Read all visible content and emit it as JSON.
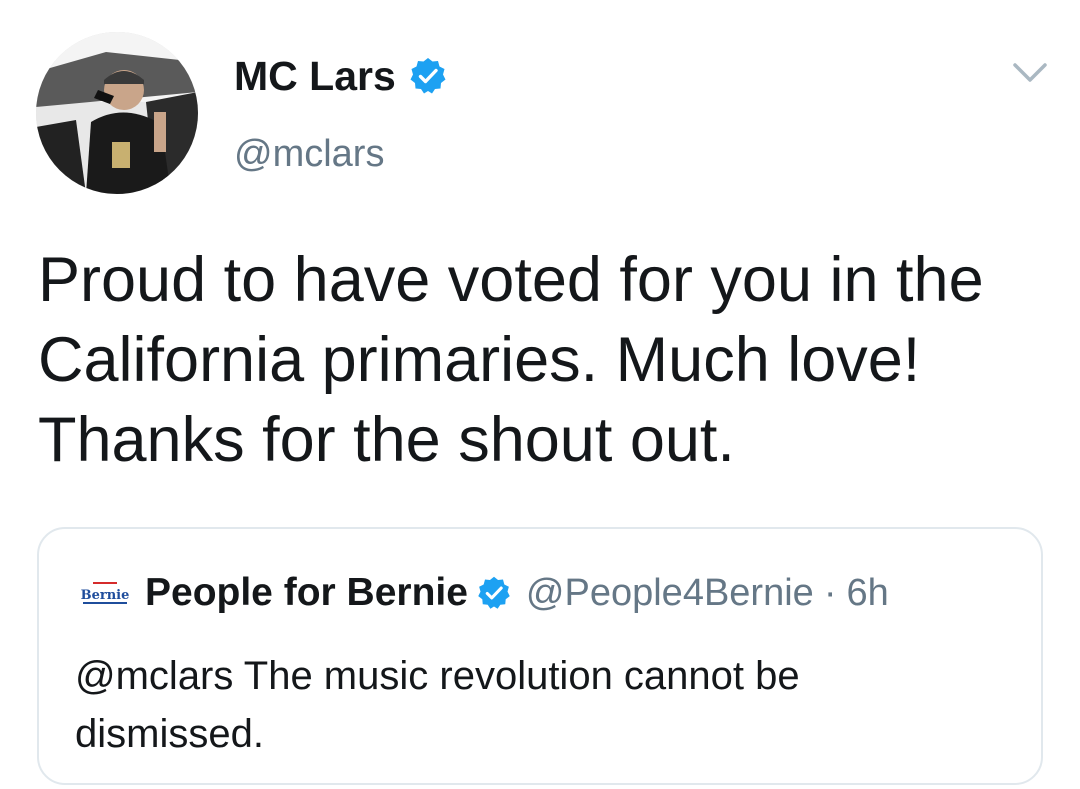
{
  "tweet": {
    "author": {
      "display_name": "MC Lars",
      "handle": "@mclars",
      "verified": true,
      "avatar_icon": "profile-photo"
    },
    "menu_icon": "chevron-down-icon",
    "text": "Proud to have voted for you in the\nCalifornia primaries.  Much love!\nThanks for the shout out."
  },
  "quoted_tweet": {
    "author": {
      "display_name": "People for Bernie",
      "handle": "@People4Bernie",
      "verified": true,
      "avatar_logo_text": "Bernie"
    },
    "separator": "·",
    "time": "6h",
    "text": "@mclars The music revolution cannot be dismissed."
  },
  "colors": {
    "verified_blue": "#1DA1F2",
    "secondary_text": "#657786",
    "primary_text": "#14171A",
    "card_border": "#E1E8ED",
    "bernie_blue": "#1f4d9c",
    "bernie_red": "#d52b2b"
  }
}
